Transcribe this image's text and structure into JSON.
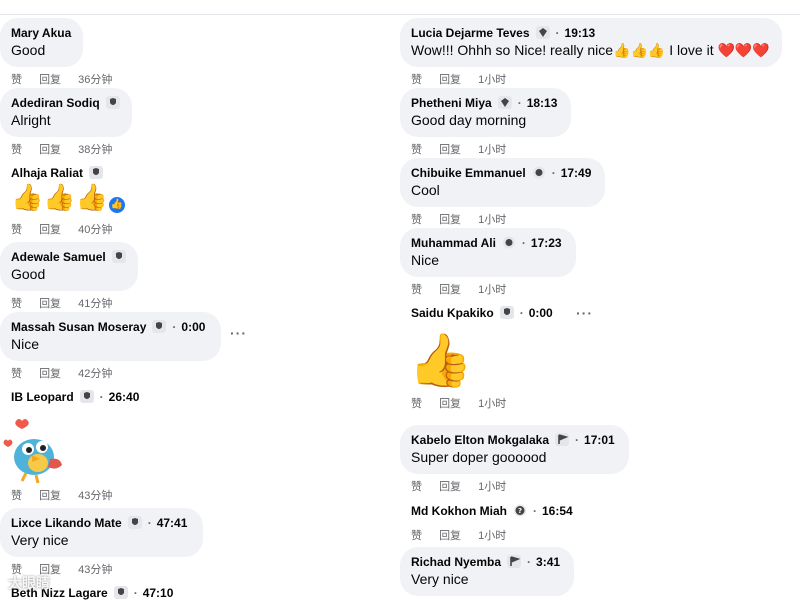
{
  "actions": {
    "like": "赞",
    "reply": "回复"
  },
  "more_icon": "more-dots-icon",
  "left_comments": [
    {
      "name": "Mary Akua",
      "text": "Good",
      "age": "36分钟"
    },
    {
      "name": "Adediran Sodiq",
      "text": "Alright",
      "age": "38分钟"
    },
    {
      "name": "Alhaja Raliat",
      "emoji": "👍👍👍",
      "age": "40分钟"
    },
    {
      "name": "Adewale Samuel",
      "text": "Good",
      "age": "41分钟"
    },
    {
      "name": "Massah Susan Moseray",
      "time": "0:00",
      "text": "Nice",
      "age": "42分钟"
    },
    {
      "name": "IB Leopard",
      "time": "26:40",
      "sticker": "bird-sticker",
      "age": "43分钟"
    },
    {
      "name": "Lixce Likando Mate",
      "time": "47:41",
      "text": "Very nice",
      "age": "43分钟"
    },
    {
      "name": "Beth Nizz Lagare",
      "time": "47:10"
    }
  ],
  "right_comments": [
    {
      "name": "Lucia Dejarme Teves",
      "time": "19:13",
      "text": "Wow!!! Ohhh so Nice! really nice👍👍👍 I love it ❤️❤️❤️",
      "age": "1小时"
    },
    {
      "name": "Phetheni Miya",
      "time": "18:13",
      "text": "Good day morning",
      "age": "1小时"
    },
    {
      "name": "Chibuike Emmanuel",
      "time": "17:49",
      "text": "Cool",
      "age": "1小时"
    },
    {
      "name": "Muhammad Ali",
      "time": "17:23",
      "text": "Nice",
      "age": "1小时"
    },
    {
      "name": "Saidu Kpakiko",
      "time": "0:00",
      "emoji": "👍",
      "age": "1小时"
    },
    {
      "name": "Kabelo Elton Mokgalaka",
      "time": "17:01",
      "text": "Super doper goooood",
      "age": "1小时"
    },
    {
      "name": "Md Kokhon Miah",
      "time": "16:54",
      "age": "1小时"
    },
    {
      "name": "Richad Nyemba",
      "time": "3:41",
      "text": "Very nice"
    }
  ],
  "reaction_badge": "like-reaction-icon",
  "watermark": "大眼睛"
}
